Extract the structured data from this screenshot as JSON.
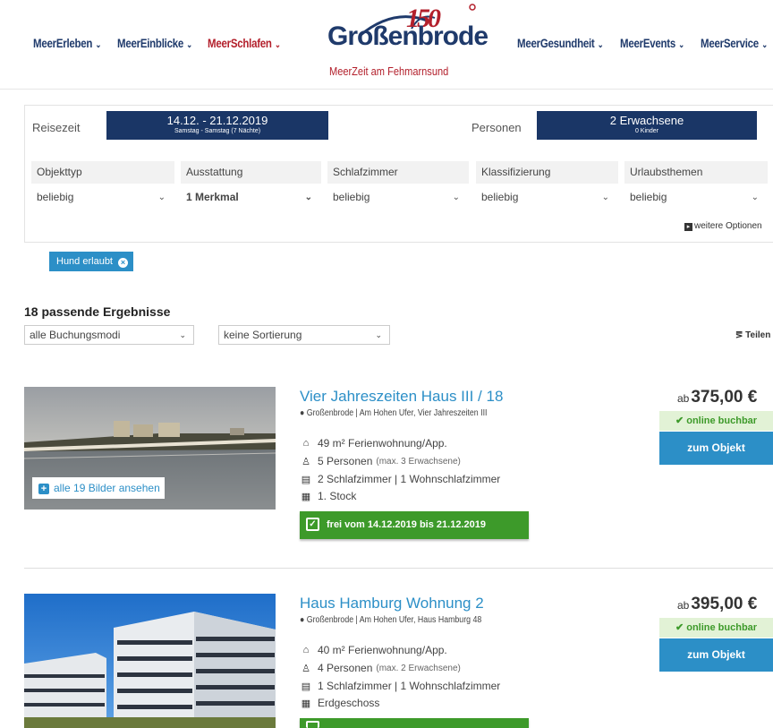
{
  "nav": {
    "left": [
      {
        "label": "MeerErleben",
        "active": false
      },
      {
        "label": "MeerEinblicke",
        "active": false
      },
      {
        "label": "MeerSchlafen",
        "active": true
      }
    ],
    "right": [
      {
        "label": "MeerGesundheit"
      },
      {
        "label": "MeerEvents"
      },
      {
        "label": "MeerService"
      }
    ]
  },
  "logo": {
    "name": "Großenbrode",
    "tagline": "MeerZeit am Fehmarnsund",
    "badge": "150"
  },
  "search": {
    "reisezeit_label": "Reisezeit",
    "dates": "14.12. - 21.12.2019",
    "dates_sub": "Samstag - Samstag (7 Nächte)",
    "personen_label": "Personen",
    "persons": "2 Erwachsene",
    "persons_sub": "0 Kinder",
    "filters": [
      {
        "label": "Objekttyp",
        "value": "beliebig",
        "bold": false
      },
      {
        "label": "Ausstattung",
        "value": "1 Merkmal",
        "bold": true
      },
      {
        "label": "Schlafzimmer",
        "value": "beliebig",
        "bold": false
      },
      {
        "label": "Klassifizierung",
        "value": "beliebig",
        "bold": false
      },
      {
        "label": "Urlaubsthemen",
        "value": "beliebig",
        "bold": false
      }
    ],
    "more_options": "weitere Optionen"
  },
  "active_tag": "Hund erlaubt",
  "results": {
    "count_text": "18 passende Ergebnisse",
    "booking_mode": "alle Buchungsmodi",
    "sorting": "keine Sortierung",
    "share": "Teilen"
  },
  "listings": [
    {
      "title": "Vier Jahreszeiten Haus III / 18",
      "location": "Großenbrode | Am Hohen Ufer, Vier Jahreszeiten III",
      "area": "49 m² Ferienwohnung/App.",
      "persons": "5 Personen",
      "persons_sub": "(max. 3 Erwachsene)",
      "rooms": "2 Schlafzimmer | 1 Wohnschlafzimmer",
      "floor": "1. Stock",
      "availability": "frei vom 14.12.2019 bis 21.12.2019",
      "price_prefix": "ab",
      "price": "375,00 €",
      "online": "online buchbar",
      "cta": "zum Objekt",
      "gallery": "alle 19 Bilder ansehen"
    },
    {
      "title": "Haus Hamburg Wohnung 2",
      "location": "Großenbrode | Am Hohen Ufer, Haus Hamburg 48",
      "area": "40 m² Ferienwohnung/App.",
      "persons": "4 Personen",
      "persons_sub": "(max. 2 Erwachsene)",
      "rooms": "1 Schlafzimmer | 1 Wohnschlafzimmer",
      "floor": "Erdgeschoss",
      "price_prefix": "ab",
      "price": "395,00 €",
      "online": "online buchbar",
      "cta": "zum Objekt"
    }
  ],
  "colors": {
    "navy": "#1a3666",
    "red": "#b3202c",
    "blue": "#2c8fc7",
    "green": "#3d9a2a"
  }
}
